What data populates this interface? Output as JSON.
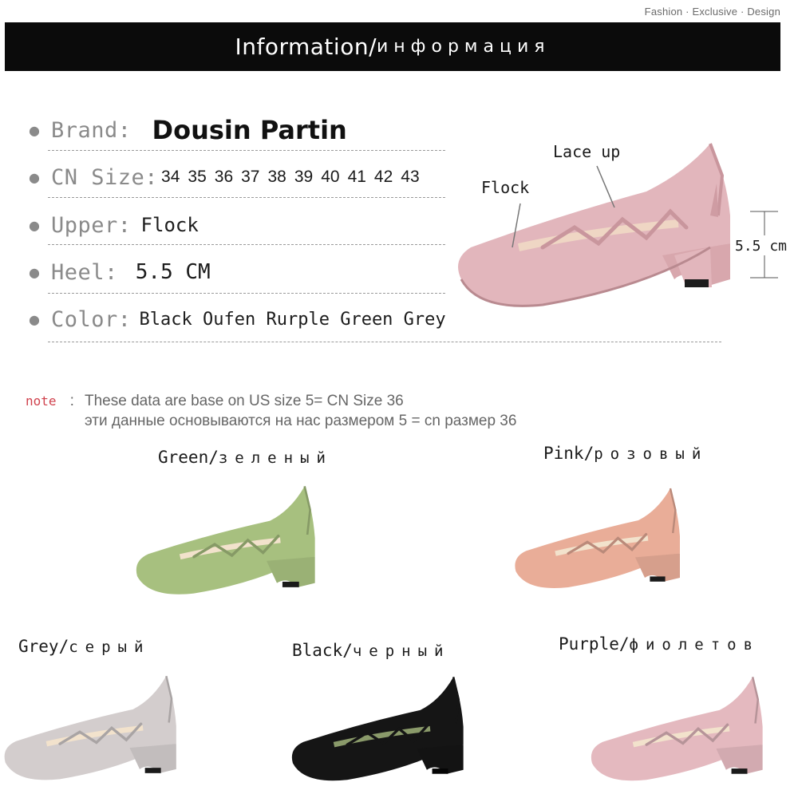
{
  "tagline": "Fashion · Exclusive · Design",
  "banner": {
    "title_en": "Information/",
    "title_ru": "информация"
  },
  "specs": {
    "brand": {
      "label": "Brand:",
      "value": "Dousin Partin"
    },
    "size": {
      "label": "CN Size:",
      "values": [
        "34",
        "35",
        "36",
        "37",
        "38",
        "39",
        "40",
        "41",
        "42",
        "43"
      ]
    },
    "upper": {
      "label": "Upper:",
      "value": "Flock"
    },
    "heel": {
      "label": "Heel:",
      "value": "5.5 CM"
    },
    "color": {
      "label": "Color:",
      "value": "Black Oufen Rurple Green  Grey"
    }
  },
  "diagram": {
    "lace_label": "Lace up",
    "flock_label": "Flock",
    "height_label": "5.5 cm",
    "shoe_color": "#e2b6bc"
  },
  "note": {
    "label": "note",
    "separator": ":",
    "line_en": "These data are base on US size 5= CN Size 36",
    "line_ru": "эти данные основываются на нас размером 5 = cn размер 36"
  },
  "variants": [
    {
      "en": "Green/",
      "ru": "зеленый",
      "color": "#a7c07f"
    },
    {
      "en": "Pink/",
      "ru": "розовый",
      "color": "#e9ad98"
    },
    {
      "en": "Grey/",
      "ru": "серый",
      "color": "#d3cdcd"
    },
    {
      "en": "Black/",
      "ru": "черный",
      "color": "#151515"
    },
    {
      "en": "Purple/",
      "ru": "фиолетов",
      "color": "#e4b9bf"
    }
  ]
}
